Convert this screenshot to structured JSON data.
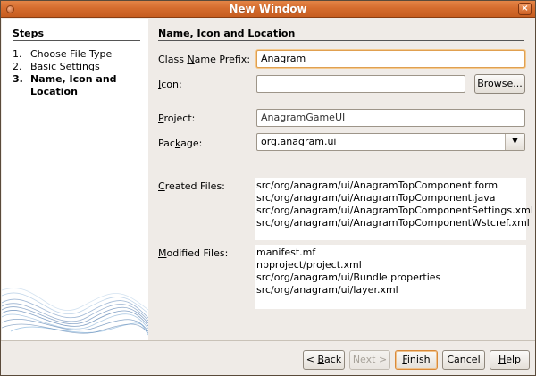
{
  "window": {
    "title": "New Window",
    "close_glyph": "×"
  },
  "steps": {
    "title": "Steps",
    "items": [
      {
        "num": "1.",
        "label": "Choose File Type",
        "current": false
      },
      {
        "num": "2.",
        "label": "Basic Settings",
        "current": false
      },
      {
        "num": "3.",
        "label": "Name, Icon and Location",
        "current": true
      }
    ]
  },
  "panel": {
    "title": "Name, Icon and Location",
    "class_name_prefix": {
      "label_pre": "Class ",
      "label_mn": "N",
      "label_post": "ame Prefix:",
      "value": "Anagram"
    },
    "icon": {
      "label_mn": "I",
      "label_post": "con:",
      "value": ""
    },
    "browse_button": {
      "label_mn": "w",
      "label_pre": "Bro",
      "label_post": "se..."
    },
    "project": {
      "label_mn": "P",
      "label_post": "roject:",
      "value": "AnagramGameUI"
    },
    "package": {
      "label_pre": "Pac",
      "label_mn": "k",
      "label_post": "age:",
      "value": "org.anagram.ui"
    },
    "created_files": {
      "label_mn": "C",
      "label_post": "reated Files:",
      "files": [
        "src/org/anagram/ui/AnagramTopComponent.form",
        "src/org/anagram/ui/AnagramTopComponent.java",
        "src/org/anagram/ui/AnagramTopComponentSettings.xml",
        "src/org/anagram/ui/AnagramTopComponentWstcref.xml"
      ]
    },
    "modified_files": {
      "label_mn": "M",
      "label_post": "odified Files:",
      "files": [
        "manifest.mf",
        "nbproject/project.xml",
        "src/org/anagram/ui/Bundle.properties",
        "src/org/anagram/ui/layer.xml"
      ]
    }
  },
  "footer": {
    "back": {
      "pre": "< ",
      "mn": "B",
      "post": "ack"
    },
    "next": "Next >",
    "finish": {
      "mn": "F",
      "post": "inish"
    },
    "cancel": "Cancel",
    "help": {
      "mn": "H",
      "post": "elp"
    }
  },
  "colors": {
    "titlebar": "#d56c2e",
    "focus": "#e0a050",
    "dialog_bg": "#efebe7"
  },
  "icons": {
    "window_menu": "window-menu-icon",
    "close": "close-icon",
    "dropdown": "chevron-down-icon"
  }
}
